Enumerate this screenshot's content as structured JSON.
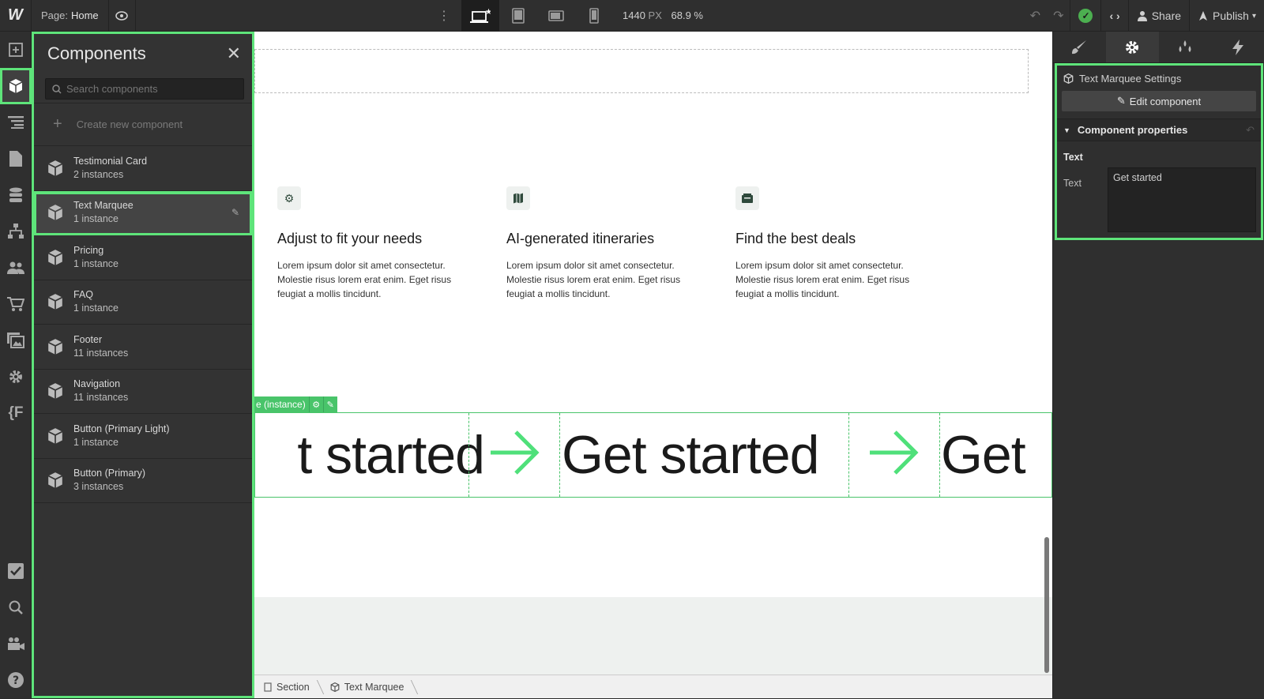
{
  "topbar": {
    "logo": "W",
    "page_prefix": "Page:",
    "page_name": "Home",
    "viewport_width": "1440",
    "viewport_unit": "PX",
    "zoom": "68.9 %",
    "share_label": "Share",
    "publish_label": "Publish"
  },
  "components_panel": {
    "title": "Components",
    "search_placeholder": "Search components",
    "create_label": "Create new component",
    "items": [
      {
        "name": "Testimonial Card",
        "count": "2 instances"
      },
      {
        "name": "Text Marquee",
        "count": "1 instance"
      },
      {
        "name": "Pricing",
        "count": "1 instance"
      },
      {
        "name": "FAQ",
        "count": "1 instance"
      },
      {
        "name": "Footer",
        "count": "11 instances"
      },
      {
        "name": "Navigation",
        "count": "11 instances"
      },
      {
        "name": "Button (Primary Light)",
        "count": "1 instance"
      },
      {
        "name": "Button (Primary)",
        "count": "3 instances"
      }
    ]
  },
  "canvas": {
    "features": [
      {
        "title": "Adjust to fit your needs",
        "text": "Lorem ipsum dolor sit amet consectetur. Molestie risus lorem erat enim. Eget risus feugiat a mollis tincidunt."
      },
      {
        "title": "AI-generated itineraries",
        "text": "Lorem ipsum dolor sit amet consectetur. Molestie risus lorem erat enim. Eget risus feugiat a mollis tincidunt."
      },
      {
        "title": "Find the best deals",
        "text": "Lorem ipsum dolor sit amet consectetur. Molestie risus lorem erat enim. Eget risus feugiat a mollis tincidunt."
      }
    ],
    "instance_tag": "e (instance)",
    "marquee": [
      "t started",
      "Get started",
      "Get"
    ]
  },
  "breadcrumbs": [
    "Section",
    "Text Marquee"
  ],
  "right_panel": {
    "settings_title": "Text Marquee Settings",
    "edit_component": "Edit component",
    "component_properties": "Component properties",
    "section_label": "Text",
    "field_label": "Text",
    "field_value": "Get started"
  },
  "colors": {
    "accent": "#5ee47a",
    "marquee_arrow": "#4fe07a",
    "selection": "#49c46a"
  }
}
